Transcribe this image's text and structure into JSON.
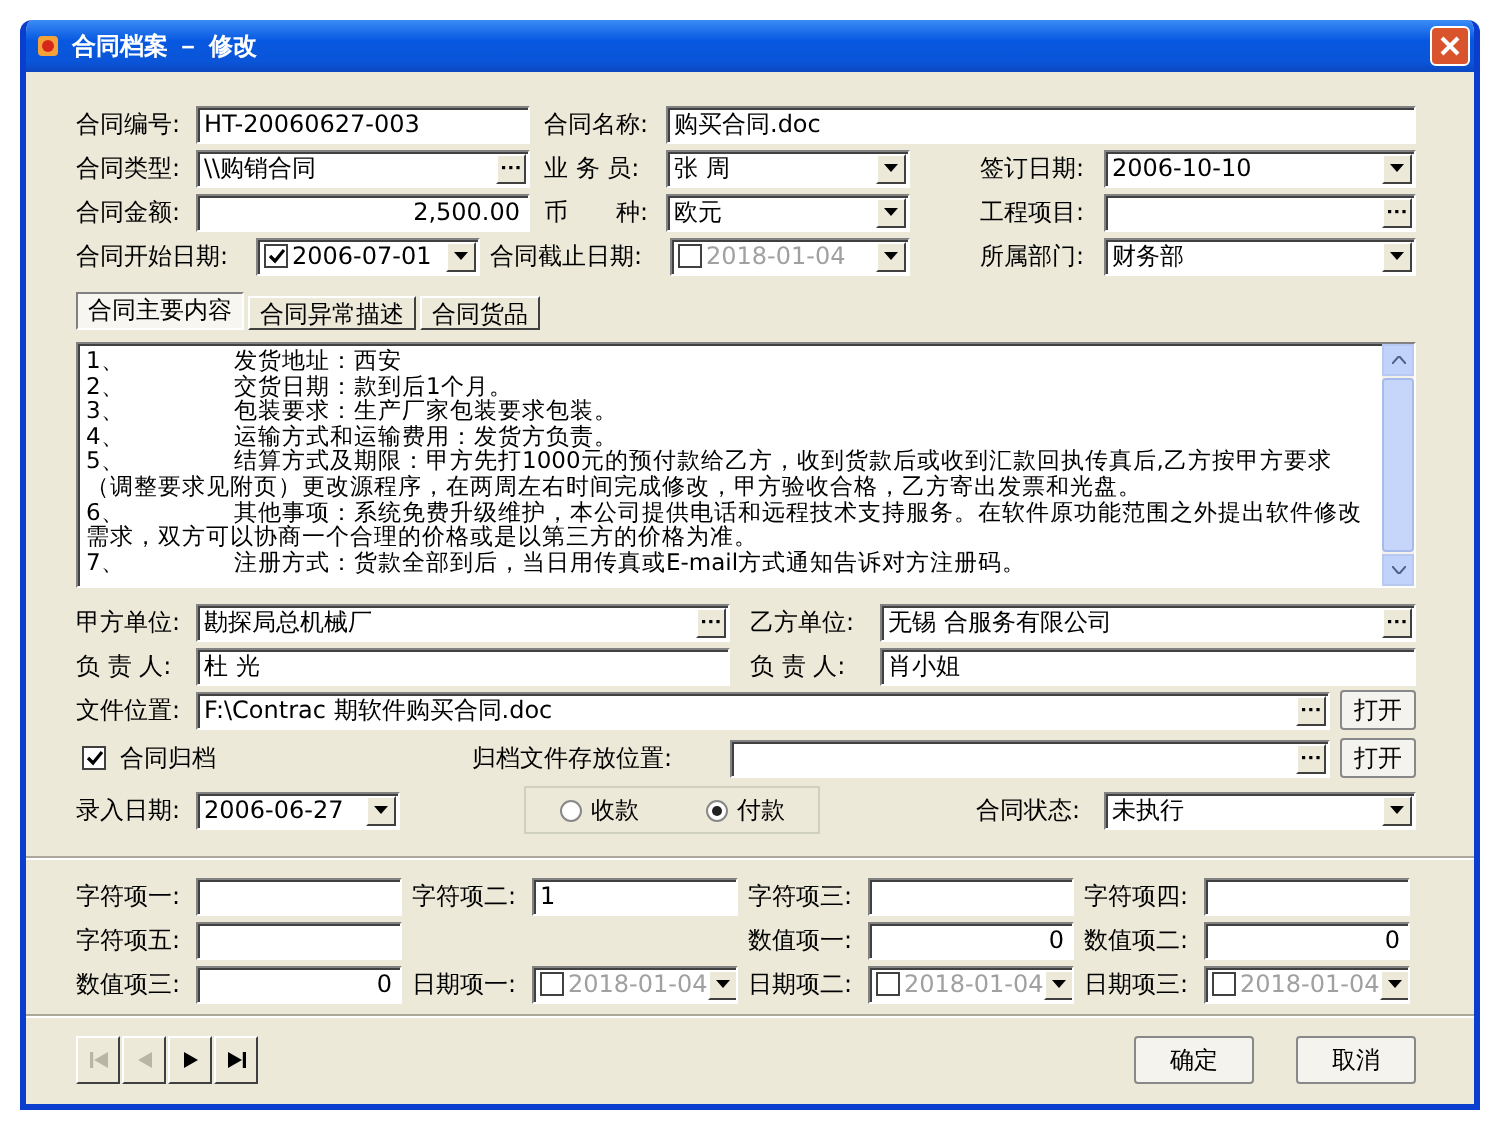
{
  "window": {
    "title": "合同档案 － 修改"
  },
  "main_fields": [
    {
      "label": "合同编号:",
      "value": "HT-20060627-003",
      "kind": "text"
    },
    {
      "label": "合同名称:",
      "value": "购买合同.doc",
      "kind": "text"
    },
    {
      "label": "合同类型:",
      "value": "\\\\购销合同",
      "kind": "browse"
    },
    {
      "label": "业 务 员:",
      "value": "张 周",
      "kind": "select"
    },
    {
      "label": "签订日期:",
      "value": "2006-10-10",
      "kind": "select"
    },
    {
      "label": "合同金额:",
      "value": "2,500.00",
      "kind": "number"
    },
    {
      "label": "币　　种:",
      "value": "欧元",
      "kind": "select"
    },
    {
      "label": "工程项目:",
      "kind": "browse"
    },
    {
      "label": "合同开始日期:",
      "value": "2006-07-01",
      "kind": "date",
      "checked": true
    },
    {
      "label": "合同截止日期:",
      "value": "2018-01-04",
      "kind": "date",
      "checked": false
    },
    {
      "label": "所属部门:",
      "value": "财务部",
      "kind": "select"
    }
  ],
  "tabs": [
    {
      "label": "合同主要内容",
      "selected": true
    },
    {
      "label": "合同异常描述",
      "selected": false
    },
    {
      "label": "合同货品",
      "selected": false
    }
  ],
  "content_lines": [
    {
      "num": "1、",
      "text": "发货地址：西安"
    },
    {
      "num": "2、",
      "text": "交货日期：款到后1个月。"
    },
    {
      "num": "3、",
      "text": "包装要求：生产厂家包装要求包装。"
    },
    {
      "num": "4、",
      "text": "运输方式和运输费用：发货方负责。"
    },
    {
      "num": "5、",
      "text": "结算方式及期限：甲方先打1000元的预付款给乙方，收到货款后或收到汇款回执传真后,乙方按甲方要求（调整要求见附页）更改源程序，在两周左右时间完成修改，甲方验收合格，乙方寄出发票和光盘。"
    },
    {
      "num": "6、",
      "text": "其他事项：系统免费升级维护，本公司提供电话和远程技术支持服务。在软件原功能范围之外提出软件修改需求，双方可以协商一个合理的价格或是以第三方的价格为准。"
    },
    {
      "num": "7、",
      "text": "注册方式：货款全部到后，当日用传真或E-mail方式通知告诉对方注册码。"
    }
  ],
  "party_fields": [
    {
      "label": "甲方单位:",
      "value": "勘探局总机械厂",
      "kind": "browse"
    },
    {
      "label": "乙方单位:",
      "value": "无锡 合服务有限公司",
      "kind": "browse"
    },
    {
      "label": "负 责 人:",
      "value": "杜 光",
      "kind": "text"
    },
    {
      "label": "负 责 人:",
      "value": "肖小姐",
      "kind": "text"
    },
    {
      "label": "文件位置:",
      "value": "F:\\Contrac 期软件购买合同.doc",
      "kind": "browse",
      "button": "打开"
    }
  ],
  "archive": {
    "label": "合同归档",
    "checked": true,
    "location_label": "归档文件存放位置:",
    "button": "打开"
  },
  "entry_date": {
    "label": "录入日期:",
    "value": "2006-06-27",
    "kind": "select"
  },
  "payment_options": [
    {
      "label": "收款",
      "selected": false
    },
    {
      "label": "付款",
      "selected": true
    }
  ],
  "status": {
    "label": "合同状态:",
    "value": "未执行",
    "kind": "select"
  },
  "custom_rows": [
    [
      {
        "label": "字符项一:",
        "kind": "text"
      },
      {
        "label": "字符项二:",
        "value": "1",
        "kind": "text"
      },
      {
        "label": "字符项三:",
        "kind": "text"
      },
      {
        "label": "字符项四:",
        "kind": "text"
      }
    ],
    [
      {
        "label": "字符项五:",
        "kind": "text"
      },
      {
        "label": "数值项一:",
        "value": "0",
        "kind": "number"
      },
      {
        "label": "数值项二:",
        "value": "0",
        "kind": "number"
      }
    ],
    [
      {
        "label": "数值项三:",
        "value": "0",
        "kind": "number"
      },
      {
        "label": "日期项一:",
        "value": "2018-01-04",
        "kind": "date",
        "checked": false
      },
      {
        "label": "日期项二:",
        "value": "2018-01-04",
        "kind": "date",
        "checked": false
      },
      {
        "label": "日期项三:",
        "value": "2018-01-04",
        "kind": "date",
        "checked": false
      }
    ]
  ],
  "nav_buttons": [
    {
      "kind": "first",
      "disabled": true
    },
    {
      "kind": "prev",
      "disabled": true
    },
    {
      "kind": "next",
      "disabled": false
    },
    {
      "kind": "last",
      "disabled": false
    }
  ],
  "buttons": [
    "确定",
    "取消"
  ]
}
